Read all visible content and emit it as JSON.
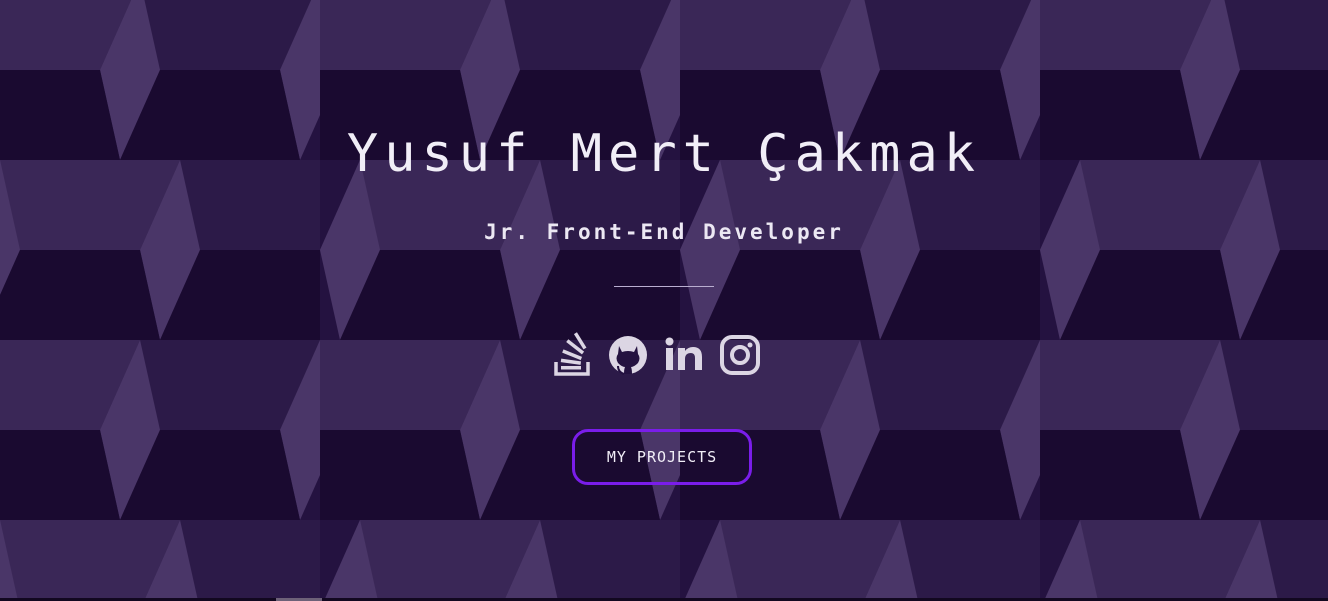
{
  "hero": {
    "name": "Yusuf Mert Çakmak",
    "role": "Jr. Front-End Developer"
  },
  "social": [
    {
      "name": "stackoverflow-icon"
    },
    {
      "name": "github-icon"
    },
    {
      "name": "linkedin-icon"
    },
    {
      "name": "instagram-icon"
    }
  ],
  "projects_button": {
    "label": "MY PROJECTS"
  },
  "colors": {
    "background": "#1f0f36",
    "accent": "#7a1dea",
    "text": "#f1eef7",
    "icon": "#dcd6e4"
  }
}
